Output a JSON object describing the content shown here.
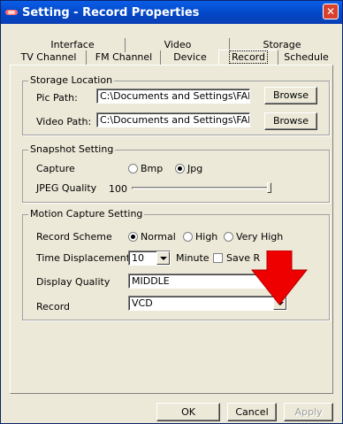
{
  "window": {
    "title": "Setting - Record Properties",
    "close_symbol": "✕"
  },
  "tabs": {
    "row1": [
      "Interface",
      "Video",
      "Storage"
    ],
    "row2": [
      "TV Channel",
      "FM Channel",
      "Device",
      "Record",
      "Schedule"
    ],
    "active": "Record"
  },
  "storage": {
    "title": "Storage Location",
    "pic_label": "Pic Path:",
    "pic_value": "C:\\Documents and Settings\\FAE\\My Do",
    "video_label": "Video Path:",
    "video_value": "C:\\Documents and Settings\\FAE\\My Do",
    "browse_label": "Browse"
  },
  "snapshot": {
    "title": "Snapshot Setting",
    "capture_label": "Capture",
    "capture_options": [
      "Bmp",
      "Jpg"
    ],
    "capture_selected": "Jpg",
    "quality_label": "JPEG Quality",
    "quality_value": "100",
    "quality_level": 1.0
  },
  "motion": {
    "title": "Motion Capture Setting",
    "scheme_label": "Record Scheme",
    "scheme_options": [
      "Normal",
      "High",
      "Very High"
    ],
    "scheme_selected": "Normal",
    "time_label": "Time Displacement",
    "time_value": "10",
    "time_unit": "Minute",
    "save_label": "Save R",
    "save_checked": false,
    "display_label": "Display Quality",
    "display_value": "MIDDLE",
    "record_label": "Record",
    "record_value": "VCD"
  },
  "footer": {
    "ok": "OK",
    "cancel": "Cancel",
    "apply": "Apply"
  },
  "colors": {
    "title_bar": "#0347c6",
    "dialog_bg": "#ece9d8",
    "arrow": "#ee0000",
    "close_button": "#d8412e"
  }
}
